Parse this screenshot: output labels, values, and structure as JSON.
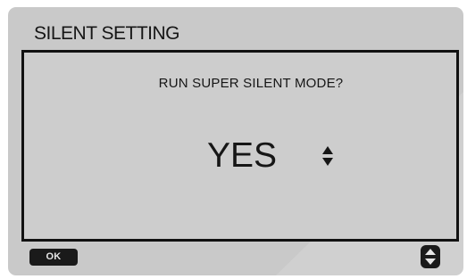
{
  "header": {
    "title": "SILENT SETTING"
  },
  "dialog": {
    "question": "RUN SUPER SILENT MODE?",
    "value": "YES",
    "value_icon": "up-down-arrows-icon"
  },
  "footer": {
    "ok_label": "OK",
    "adjust_icon": "up-down-arrows-icon"
  },
  "colors": {
    "screen_background": "#c9c9c9",
    "text": "#161616",
    "frame": "#111111",
    "button_background": "#1a1a1a",
    "button_text": "#e6e6e6"
  }
}
